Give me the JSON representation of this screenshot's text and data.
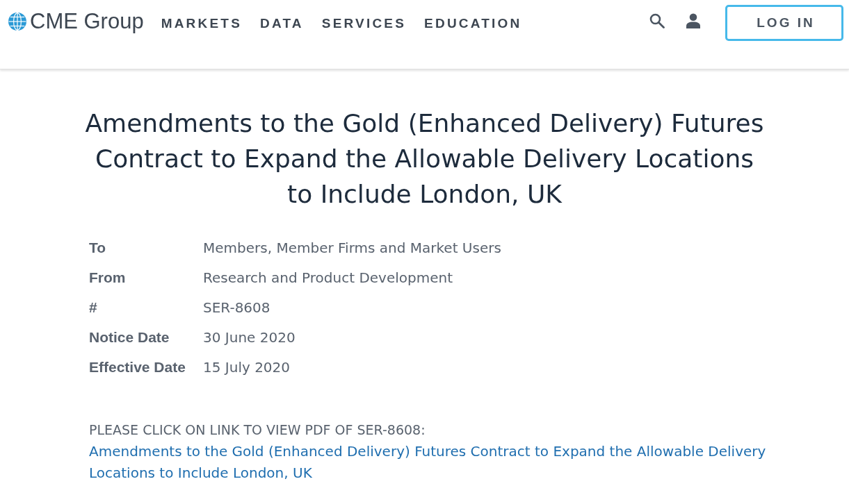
{
  "header": {
    "logo": {
      "text": "CME Group"
    },
    "nav": [
      "MARKETS",
      "DATA",
      "SERVICES",
      "EDUCATION"
    ],
    "login_button": "LOG IN"
  },
  "notice": {
    "title": "Amendments to the Gold (Enhanced Delivery) Futures Contract to Expand the Allowable Delivery Locations to Include London, UK",
    "fields": [
      {
        "label": "To",
        "value": "Members, Member Firms and Market Users"
      },
      {
        "label": "From",
        "value": "Research and Product Development"
      },
      {
        "label": "#",
        "value": "SER-8608"
      },
      {
        "label": "Notice Date",
        "value": "30 June 2020"
      },
      {
        "label": "Effective Date",
        "value": "15 July 2020"
      }
    ],
    "pdf_prompt": "PLEASE CLICK ON LINK TO VIEW PDF OF SER-8608:",
    "pdf_link": "Amendments to the Gold (Enhanced Delivery) Futures Contract to Expand the Allowable Delivery Locations to Include London, UK"
  }
}
